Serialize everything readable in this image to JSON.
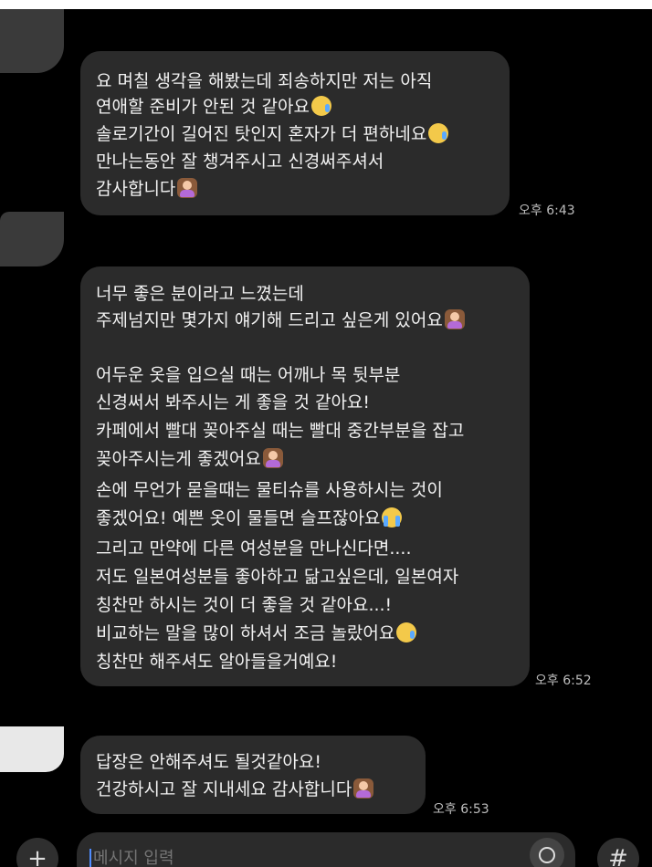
{
  "chat": {
    "messages": [
      {
        "lines": [
          {
            "text": "요 며칠 생각을 해봤는데 죄송하지만 저는 아직",
            "emoji": ""
          },
          {
            "text": "연애할 준비가 안된 것 같아요",
            "emoji": "tongue-face"
          },
          {
            "text": "솔로기간이 길어진 탓인지 혼자가 더 편하네요",
            "emoji": "tongue-face"
          },
          {
            "text": "만나는동안 잘 챙겨주시고 신경써주셔서",
            "emoji": ""
          },
          {
            "text": "감사합니다",
            "emoji": "woman-bowing"
          }
        ],
        "time": "오후 6:43"
      },
      {
        "lines": [
          {
            "text": "너무 좋은 분이라고 느꼈는데",
            "emoji": ""
          },
          {
            "text": "주제넘지만 몇가지 얘기해 드리고 싶은게 있어요",
            "emoji": "woman-bowing"
          },
          {
            "text": "",
            "emoji": ""
          },
          {
            "text": "어두운 옷을 입으실 때는 어깨나 목 뒷부분",
            "emoji": ""
          },
          {
            "text": "신경써서 봐주시는 게 좋을 것 같아요!",
            "emoji": ""
          },
          {
            "text": "카페에서 빨대 꽂아주실 때는 빨대 중간부분을 잡고",
            "emoji": ""
          },
          {
            "text": "꽂아주시는게 좋겠어요",
            "emoji": "woman-bowing"
          },
          {
            "text": "손에 무언가 묻을때는 물티슈를 사용하시는 것이",
            "emoji": ""
          },
          {
            "text": "좋겠어요! 예쁜 옷이 물들면 슬프잖아요",
            "emoji": "crying-face"
          },
          {
            "text": "그리고 만약에 다른 여성분을 만나신다면....",
            "emoji": ""
          },
          {
            "text": "저도 일본여성분들 좋아하고 닮고싶은데, 일본여자",
            "emoji": ""
          },
          {
            "text": "칭찬만 하시는 것이 더 좋을 것 같아요...!",
            "emoji": ""
          },
          {
            "text": "비교하는 말을 많이 하셔서 조금 놀랐어요",
            "emoji": "tongue-face"
          },
          {
            "text": "칭찬만 해주셔도 알아들을거예요!",
            "emoji": ""
          }
        ],
        "time": "오후 6:52"
      },
      {
        "lines": [
          {
            "text": "답장은 안해주셔도 될것같아요!",
            "emoji": ""
          },
          {
            "text": "건강하시고 잘 지내세요 감사합니다",
            "emoji": "woman-bowing"
          }
        ],
        "time": "오후 6:53"
      }
    ]
  },
  "composer": {
    "placeholder": "메시지 입력",
    "add_icon": "plus-icon",
    "emoji_icon": "smile-icon",
    "hash_icon": "hash-icon",
    "add_symbol": "+",
    "hash_symbol": "#"
  },
  "colors": {
    "background": "#000000",
    "bubble": "#2b2b2b",
    "text": "#f2f2f2",
    "time": "#bdbdbd",
    "cursor": "#4f8cff"
  }
}
